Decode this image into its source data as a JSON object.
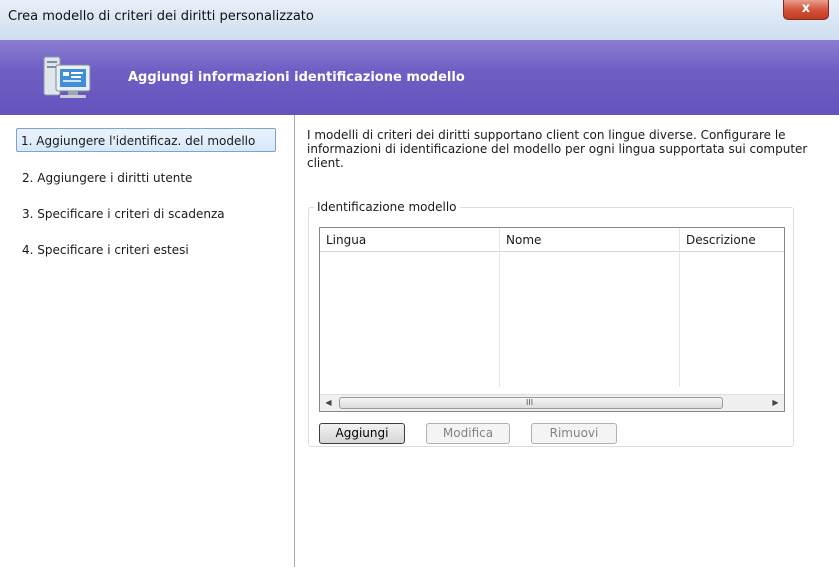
{
  "window": {
    "title": "Crea modello di criteri dei diritti personalizzato",
    "close_label": "x"
  },
  "banner": {
    "title": "Aggiungi informazioni identificazione modello",
    "icon": "computer-wizard-icon"
  },
  "steps": [
    {
      "label": "1. Aggiungere l'identificaz. del modello",
      "active": true
    },
    {
      "label": "2. Aggiungere i diritti utente",
      "active": false
    },
    {
      "label": "3. Specificare i criteri di scadenza",
      "active": false
    },
    {
      "label": "4. Specificare i criteri estesi",
      "active": false
    }
  ],
  "main": {
    "description": "I modelli di criteri dei diritti supportano client con lingue diverse. Configurare le informazioni di identificazione del modello per ogni lingua supportata sui computer client.",
    "group_title": "Identificazione modello",
    "columns": [
      "Lingua",
      "Nome",
      "Descrizione"
    ],
    "rows": [],
    "scroll_grip": "III",
    "buttons": {
      "add": "Aggiungi",
      "edit": "Modifica",
      "remove": "Rimuovi"
    }
  },
  "colors": {
    "banner": "#6f5fc4",
    "close": "#c2391f",
    "selection": "#d6e8fb"
  }
}
